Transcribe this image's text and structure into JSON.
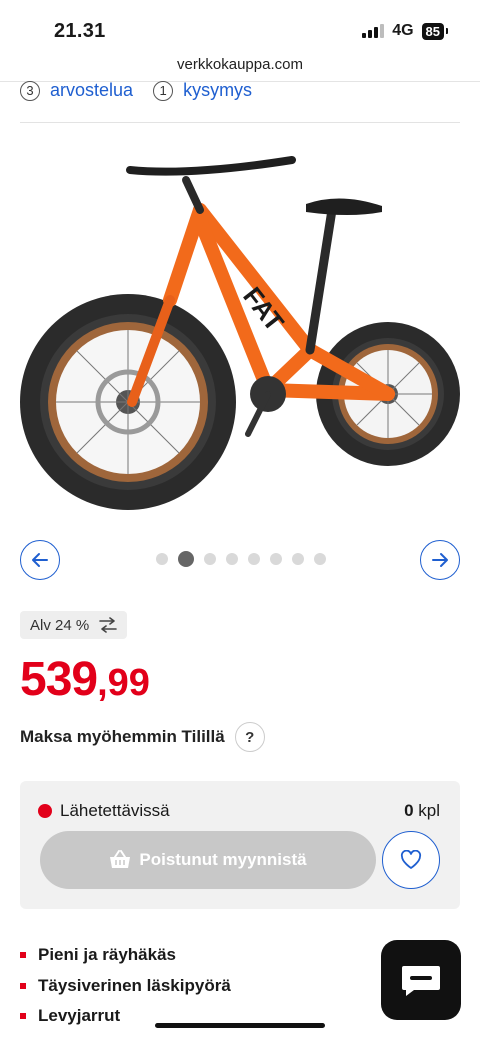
{
  "status_bar": {
    "time": "21.31",
    "network": "4G",
    "battery": "85"
  },
  "browser": {
    "url": "verkkokauppa.com"
  },
  "meta": {
    "reviews_count": "3",
    "reviews_label": "arvostelua",
    "questions_count": "1",
    "questions_label": "kysymys"
  },
  "carousel": {
    "total_images": 8,
    "active_index": 1,
    "frame_brand": "FAT"
  },
  "pricing": {
    "vat_label": "Alv 24 %",
    "price_int": "539",
    "price_dec": ",99",
    "accent_color": "#e2001a"
  },
  "payment": {
    "pay_later_label": "Maksa myöhemmin Tilillä",
    "help_label": "?"
  },
  "stock": {
    "status_label": "Lähetettävissä",
    "status_color": "#e2001a",
    "qty_value": "0",
    "qty_unit": "kpl"
  },
  "actions": {
    "buy_label": "Poistunut myynnistä"
  },
  "features": [
    "Pieni ja räyhäkäs",
    "Täysiverinen läskipyörä",
    "Levyjarrut"
  ]
}
